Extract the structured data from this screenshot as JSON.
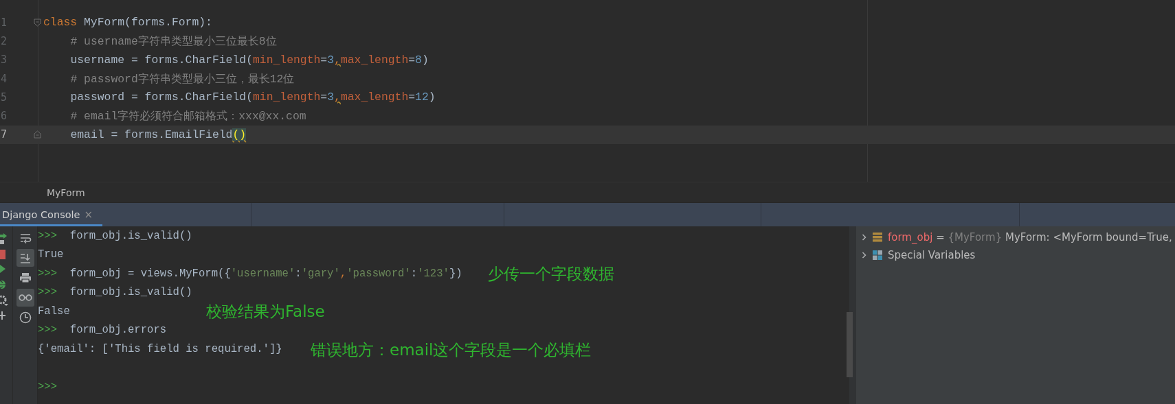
{
  "editor": {
    "lines": [
      {
        "number": "1",
        "kind": "fold-start",
        "current": false,
        "tokens": [
          {
            "text": "class ",
            "kind": "keyword"
          },
          {
            "text": "MyForm(forms.Form):",
            "kind": "plain"
          }
        ],
        "children": [
          {
            "number": "2",
            "kind": "code",
            "current": false,
            "tokens": [
              {
                "text": "# username字符串类型最小三位最长8位",
                "kind": "comment"
              }
            ]
          },
          {
            "number": "3",
            "kind": "code",
            "current": false,
            "tokens": [
              {
                "text": "username = forms.CharField(",
                "kind": "plain"
              },
              {
                "text": "min_length",
                "kind": "param"
              },
              {
                "text": "=",
                "kind": "plain"
              },
              {
                "text": "3",
                "kind": "number"
              },
              {
                "text": ",",
                "kind": "warn"
              },
              {
                "text": "max_length",
                "kind": "param"
              },
              {
                "text": "=",
                "kind": "plain"
              },
              {
                "text": "8",
                "kind": "number"
              },
              {
                "text": ")",
                "kind": "plain"
              }
            ]
          },
          {
            "number": "4",
            "kind": "code",
            "current": false,
            "tokens": [
              {
                "text": "# password字符串类型最小三位，最长12位",
                "kind": "comment"
              }
            ]
          },
          {
            "number": "5",
            "kind": "code",
            "current": false,
            "tokens": [
              {
                "text": "password = forms.CharField(",
                "kind": "plain"
              },
              {
                "text": "min_length",
                "kind": "param"
              },
              {
                "text": "=",
                "kind": "plain"
              },
              {
                "text": "3",
                "kind": "number"
              },
              {
                "text": ",",
                "kind": "warn"
              },
              {
                "text": "max_length",
                "kind": "param"
              },
              {
                "text": "=",
                "kind": "plain"
              },
              {
                "text": "12",
                "kind": "number"
              },
              {
                "text": ")",
                "kind": "plain"
              }
            ]
          },
          {
            "number": "6",
            "kind": "code",
            "current": false,
            "tokens": [
              {
                "text": "# email字符必须符合邮箱格式：xxx@xx.com",
                "kind": "comment"
              }
            ]
          },
          {
            "number": "7",
            "kind": "fold-end",
            "current": true,
            "tokens": [
              {
                "text": "email = forms.EmailField",
                "kind": "plain"
              },
              {
                "text": "()",
                "kind": "bracket"
              }
            ]
          }
        ]
      }
    ]
  },
  "breadcrumb": "MyForm",
  "console_tab": {
    "label": "Django Console",
    "close": "×",
    "selected": true
  },
  "console": {
    "toolbar": [
      {
        "kind": "wrap",
        "selected": false
      },
      {
        "kind": "scroll-end",
        "selected": true
      },
      {
        "kind": "print",
        "selected": false
      },
      {
        "kind": "glasses",
        "selected": true
      },
      {
        "kind": "history",
        "selected": false
      }
    ],
    "lines": [
      {
        "kind": "input",
        "prompt": ">>>",
        "tokens": [
          {
            "text": "form_obj.is_valid()",
            "kind": "plain"
          }
        ]
      },
      {
        "kind": "output",
        "tokens": [
          {
            "text": "True",
            "kind": "plain"
          }
        ]
      },
      {
        "kind": "input",
        "prompt": ">>>",
        "tokens": [
          {
            "text": "form_obj = views.MyForm({",
            "kind": "plain"
          },
          {
            "text": "'username'",
            "kind": "string"
          },
          {
            "text": ":",
            "kind": "plain"
          },
          {
            "text": "'gary'",
            "kind": "string"
          },
          {
            "text": ",",
            "kind": "keyword"
          },
          {
            "text": "'password'",
            "kind": "string"
          },
          {
            "text": ":",
            "kind": "plain"
          },
          {
            "text": "'123'",
            "kind": "string"
          },
          {
            "text": "})",
            "kind": "plain"
          }
        ]
      },
      {
        "kind": "input",
        "prompt": ">>>",
        "tokens": [
          {
            "text": "form_obj.is_valid()",
            "kind": "plain"
          }
        ]
      },
      {
        "kind": "output",
        "tokens": [
          {
            "text": "False",
            "kind": "plain"
          }
        ]
      },
      {
        "kind": "input",
        "prompt": ">>>",
        "tokens": [
          {
            "text": "form_obj.errors",
            "kind": "plain"
          }
        ]
      },
      {
        "kind": "output",
        "tokens": [
          {
            "text": "{'email': ['This field is required.']}",
            "kind": "plain"
          }
        ]
      },
      {
        "kind": "blank"
      },
      {
        "kind": "input",
        "prompt": ">>>"
      }
    ],
    "annotations": [
      "少传一个字段数据",
      "校验结果为False",
      "错误地方：email这个字段是一个必填栏"
    ]
  },
  "variables": [
    {
      "kind": "object",
      "name": "form_obj",
      "eq": "=",
      "type": "{MyForm}",
      "value": "MyForm: <MyForm bound=True,",
      "expanded": false
    },
    {
      "kind": "group",
      "name": "Special Variables",
      "expanded": false
    }
  ]
}
